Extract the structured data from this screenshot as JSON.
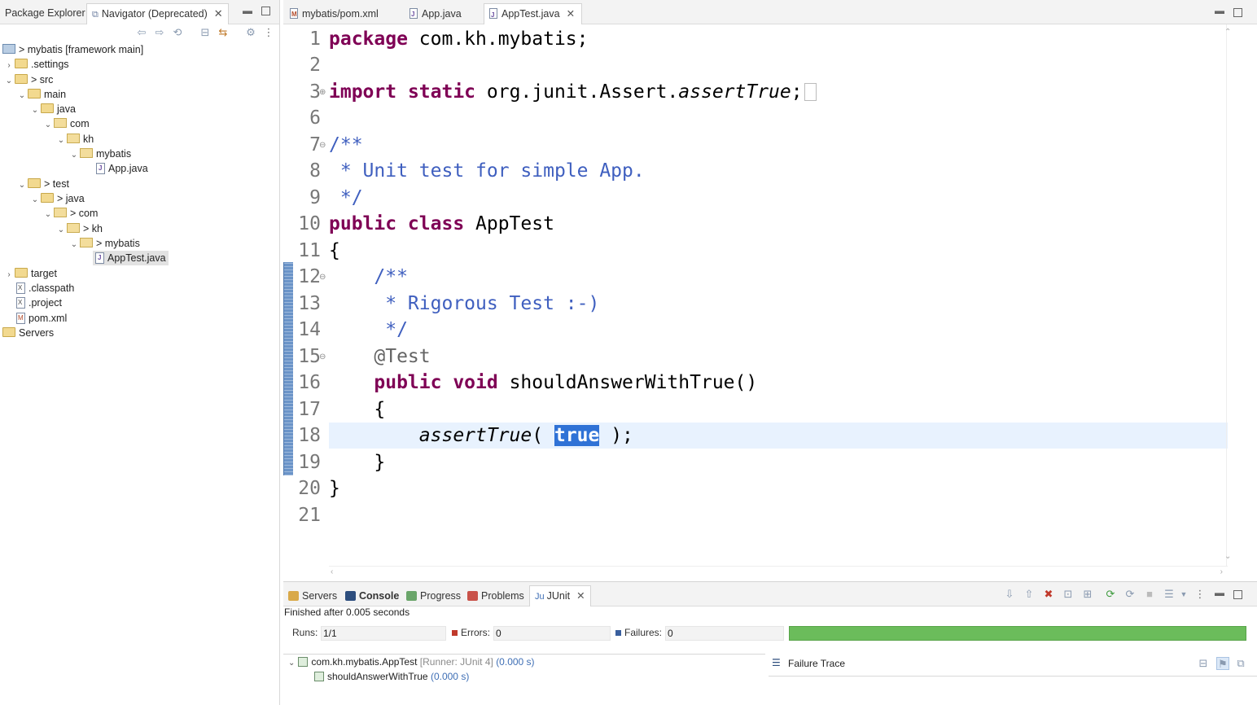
{
  "left_panel": {
    "tabs": [
      {
        "label": "Package Explorer"
      },
      {
        "label": "Navigator (Deprecated)"
      }
    ],
    "tree": [
      {
        "label": "> mybatis [framework main]"
      },
      {
        "label": ".settings"
      },
      {
        "label": "> src"
      },
      {
        "label": "main"
      },
      {
        "label": "java"
      },
      {
        "label": "com"
      },
      {
        "label": "kh"
      },
      {
        "label": "mybatis"
      },
      {
        "label": "App.java"
      },
      {
        "label": "> test"
      },
      {
        "label": "> java"
      },
      {
        "label": "> com"
      },
      {
        "label": "> kh"
      },
      {
        "label": "> mybatis"
      },
      {
        "label": "AppTest.java"
      },
      {
        "label": "target"
      },
      {
        "label": ".classpath"
      },
      {
        "label": ".project"
      },
      {
        "label": "pom.xml"
      },
      {
        "label": "Servers"
      }
    ]
  },
  "editor": {
    "tabs": [
      {
        "label": "mybatis/pom.xml"
      },
      {
        "label": "App.java"
      },
      {
        "label": "AppTest.java"
      }
    ],
    "line_numbers": [
      "1",
      "2",
      "3",
      "6",
      "7",
      "8",
      "9",
      "10",
      "11",
      "12",
      "13",
      "14",
      "15",
      "16",
      "17",
      "18",
      "19",
      "20",
      "21"
    ],
    "code": {
      "l1_kw": "package",
      "l1_rest": " com.kh.mybatis;",
      "l3_kw1": "import",
      "l3_kw2": " static",
      "l3_rest": " org.junit.Assert.",
      "l3_it": "assertTrue",
      "l3_end": ";",
      "l7": "/**",
      "l8": " * Unit test for simple App.",
      "l9": " */",
      "l10_kw": "public class",
      "l10_rest": " AppTest",
      "l11": "{",
      "l12": "    /**",
      "l13": "     * Rigorous Test :-)",
      "l14": "     */",
      "l15": "    @Test",
      "l16_kw": "    public void",
      "l16_rest": " shouldAnswerWithTrue()",
      "l17": "    {",
      "l18_pre": "        ",
      "l18_it": "assertTrue",
      "l18_mid": "( ",
      "l18_hl": "true",
      "l18_end": " );",
      "l19": "    }",
      "l20": "}"
    }
  },
  "bottom_panel": {
    "tabs": [
      {
        "label": "Servers"
      },
      {
        "label": "Console"
      },
      {
        "label": "Progress"
      },
      {
        "label": "Problems"
      },
      {
        "label": "JUnit"
      }
    ],
    "status": "Finished after 0.005 seconds",
    "runs_label": "Runs:",
    "runs_value": "1/1",
    "errors_label": "Errors:",
    "errors_value": "0",
    "failures_label": "Failures:",
    "failures_value": "0",
    "progress_fraction": 1.0,
    "result_suite": "com.kh.mybatis.AppTest",
    "result_runner": "[Runner: JUnit 4]",
    "result_suite_time": "(0.000 s)",
    "result_test": "shouldAnswerWithTrue",
    "result_test_time": "(0.000 s)",
    "failure_trace_label": "Failure Trace"
  },
  "colors": {
    "keyword": "#7f0055",
    "comment": "#3f5fbf",
    "progress_green": "#6bbc5b",
    "selection": "#2f72d6"
  }
}
